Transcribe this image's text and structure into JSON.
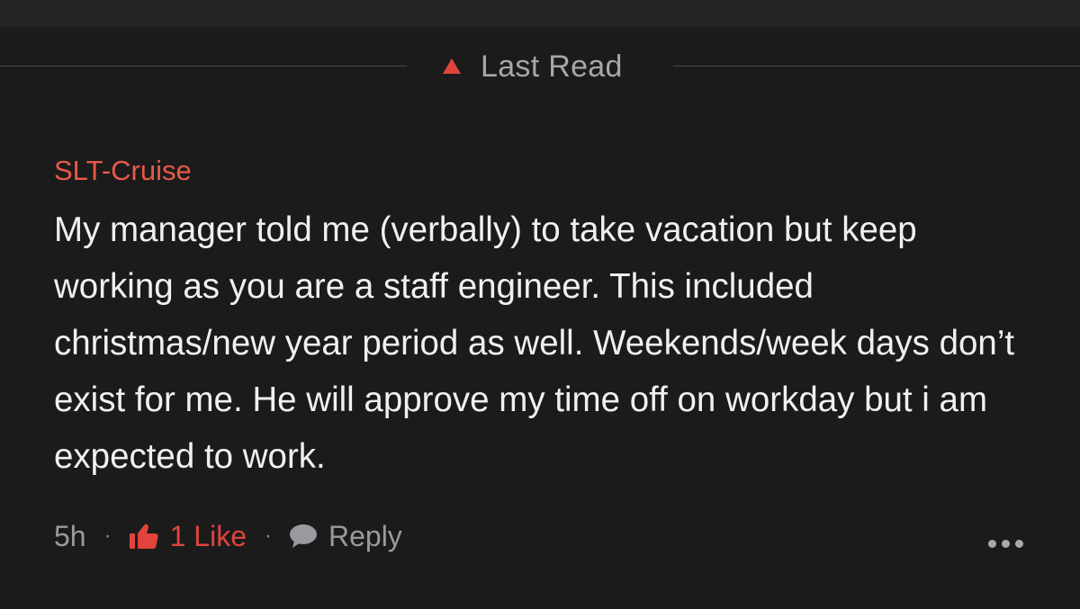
{
  "last_read": {
    "label": "Last Read",
    "icon": "triangle-up-icon",
    "icon_color": "#e0443d"
  },
  "comment": {
    "author": "SLT-Cruise",
    "author_color": "#e85a4a",
    "text": "My manager told me (verbally) to take vacation but keep working as you are a staff engineer. This included christmas/new year period as well. Weekends/week days don’t exist for me. He will approve my time off on workday but i am expected to work.",
    "timestamp": "5h",
    "separator": "·",
    "like_label": "1 Like",
    "like_color": "#e0443d",
    "reply_label": "Reply",
    "more_icon": "more-horizontal-icon"
  },
  "colors": {
    "background": "#1b1b1c",
    "top_band": "#242425",
    "divider": "#4a4a4c"
  }
}
